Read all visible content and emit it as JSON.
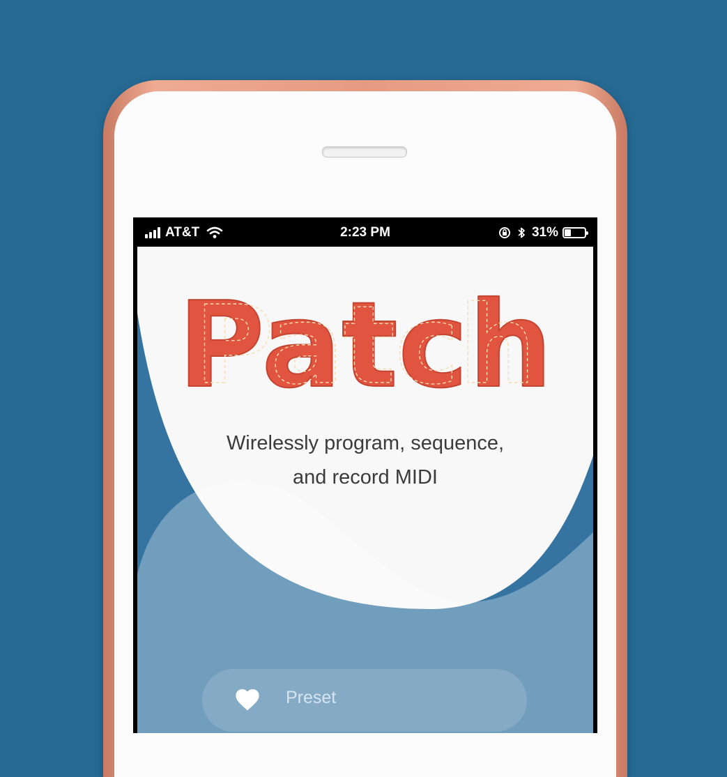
{
  "status_bar": {
    "carrier": "AT&T",
    "time": "2:23 PM",
    "battery_percent": "31%",
    "battery_level": 0.31,
    "icons": [
      "signal-icon",
      "wifi-icon",
      "orientation-lock-icon",
      "bluetooth-icon",
      "battery-icon"
    ]
  },
  "app": {
    "logo_text": "Patch",
    "subtitle_line1": "Wirelessly program, sequence,",
    "subtitle_line2": "and record MIDI",
    "preset_button": {
      "label": "Preset",
      "icon": "heart-icon"
    }
  },
  "colors": {
    "background": "#266a94",
    "app_blue": "#3574a1",
    "logo_red": "#e05440",
    "phone_case": "#e59b82"
  }
}
